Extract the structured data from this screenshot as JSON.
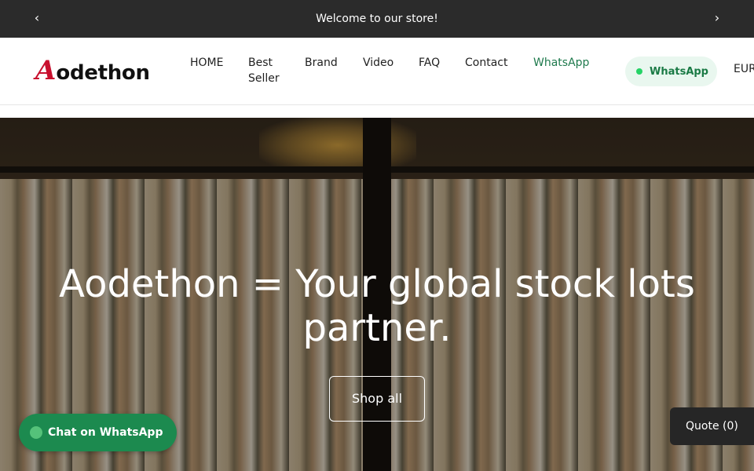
{
  "announcement": {
    "text": "Welcome to our store!",
    "prev_glyph": "‹",
    "next_glyph": "›"
  },
  "header": {
    "logo": {
      "mark": "A",
      "word": "odethon"
    },
    "nav": [
      "HOME",
      "Best Seller",
      "Brand",
      "Video",
      "FAQ",
      "Contact",
      "WhatsApp"
    ],
    "whatsapp_pill": "WhatsApp",
    "currency": "EUR"
  },
  "hero": {
    "title": "Aodethon = Your global stock lots partner.",
    "button": "Shop all"
  },
  "chat": {
    "label": "Chat on WhatsApp",
    "icon": "whatsapp-icon"
  },
  "quote": {
    "label": "Quote (0)"
  },
  "colors": {
    "brand_red": "#c8102e",
    "whatsapp_green": "#1c8a4f",
    "nav_whatsapp": "#1f7a4d",
    "topbar": "#2b2b2b"
  }
}
